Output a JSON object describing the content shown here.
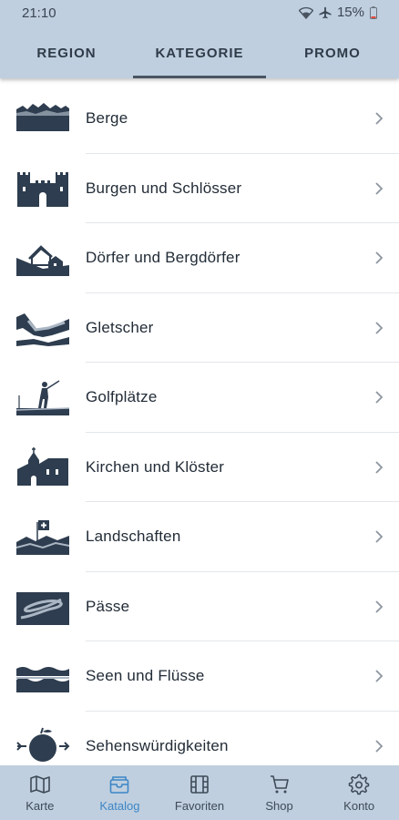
{
  "status": {
    "time": "21:10",
    "battery": "15%"
  },
  "tabs": [
    {
      "label": "REGION",
      "active": false
    },
    {
      "label": "KATEGORIE",
      "active": true
    },
    {
      "label": "PROMO",
      "active": false
    }
  ],
  "categories": [
    {
      "label": "Berge",
      "icon": "mountain-icon"
    },
    {
      "label": "Burgen und Schlösser",
      "icon": "castle-icon"
    },
    {
      "label": "Dörfer und Bergdörfer",
      "icon": "village-icon"
    },
    {
      "label": "Gletscher",
      "icon": "glacier-icon"
    },
    {
      "label": "Golfplätze",
      "icon": "golfer-icon"
    },
    {
      "label": "Kirchen und Klöster",
      "icon": "church-icon"
    },
    {
      "label": "Landschaften",
      "icon": "landscape-flag-icon"
    },
    {
      "label": "Pässe",
      "icon": "mountain-pass-icon"
    },
    {
      "label": "Seen und Flüsse",
      "icon": "lake-icon"
    },
    {
      "label": "Sehenswürdigkeiten",
      "icon": "apple-arrow-icon"
    }
  ],
  "bottom_nav": [
    {
      "label": "Karte",
      "icon": "map-icon",
      "active": false
    },
    {
      "label": "Katalog",
      "icon": "catalog-icon",
      "active": true
    },
    {
      "label": "Favoriten",
      "icon": "film-icon",
      "active": false
    },
    {
      "label": "Shop",
      "icon": "cart-icon",
      "active": false
    },
    {
      "label": "Konto",
      "icon": "gear-icon",
      "active": false
    }
  ],
  "colors": {
    "header_bg": "#bfcfdf",
    "accent": "#3d86c6",
    "icon_dark": "#2e3d4f"
  }
}
